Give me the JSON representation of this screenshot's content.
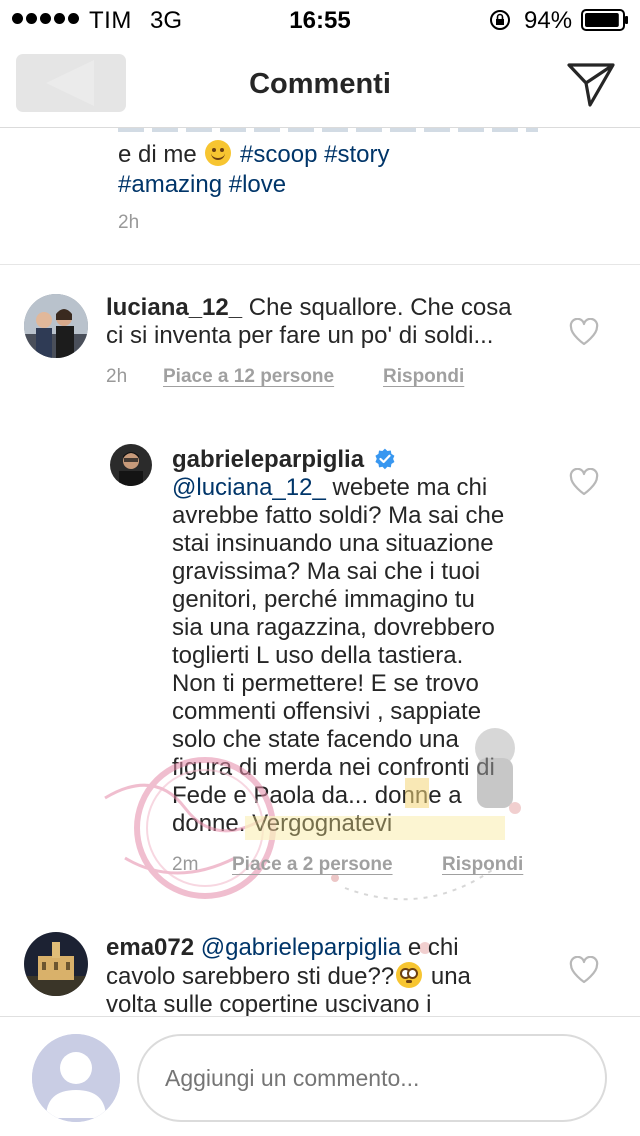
{
  "status_bar": {
    "carrier": "TIM",
    "network": "3G",
    "time": "16:55",
    "battery": "94%",
    "battery_level": 0.94
  },
  "nav": {
    "title": "Commenti",
    "back_icon": "chevron-left-icon",
    "send_icon": "paper-plane-icon"
  },
  "caption": {
    "line1": "e di me",
    "emoji": "smiling-face-emoji",
    "line1_tags": "#scoop #story",
    "line2_tags": "#amazing #love",
    "time": "2h"
  },
  "comments": [
    {
      "username": "luciana_12_",
      "lines": [
        "Che squallore. Che cosa",
        "ci si inventa per fare un po' di soldi..."
      ],
      "time": "2h",
      "likes": "Piace a 12 persone",
      "reply": "Rispondi"
    },
    {
      "username": "gabrieleparpiglia",
      "verified": true,
      "mention": "@luciana_12_",
      "first_line_rest": "webete ma chi",
      "lines": [
        "avrebbe fatto soldi? Ma sai che",
        "stai insinuando una situazione",
        "gravissima? Ma sai che i tuoi",
        "genitori, perché immagino tu",
        "sia una ragazzina, dovrebbero",
        "toglierti L uso della tastiera.",
        "Non ti permettere! E se trovo",
        "commenti offensivi , sappiate",
        "solo che state facendo una",
        "figura di merda nei confronti di",
        "Fede e Paola da... donne a",
        "donne. Vergognatevi"
      ],
      "time": "2m",
      "likes": "Piace a 2 persone",
      "reply": "Rispondi"
    },
    {
      "username": "ema072",
      "mention": "@gabrieleparpiglia",
      "first_line_rest": "e chi",
      "line2": "cavolo sarebbero sti due??",
      "line2_emoji": "flushed-face-emoji",
      "line2_rest": "una",
      "line3": "volta sulle copertine uscivano i"
    }
  ],
  "input": {
    "placeholder": "Aggiungi un commento..."
  },
  "colors": {
    "link": "#003569",
    "meta": "#999999",
    "text": "#262626",
    "verified": "#3897f0"
  }
}
